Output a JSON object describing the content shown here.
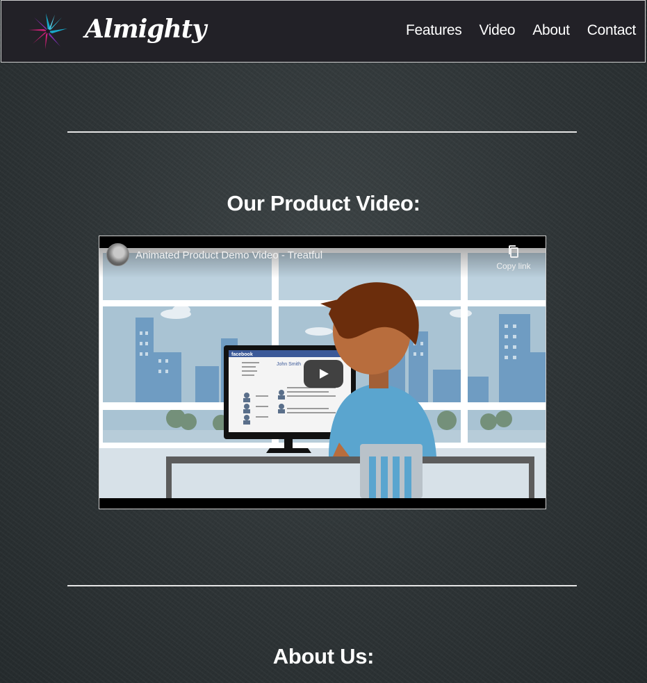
{
  "header": {
    "brand": "Almighty",
    "nav": [
      "Features",
      "Video",
      "About",
      "Contact"
    ]
  },
  "video_section": {
    "title": "Our Product Video:",
    "player": {
      "video_title": "Animated Product Demo Video - Treatful",
      "copy_link_label": "Copy link",
      "screen_app_name": "facebook",
      "screen_profile_name": "John Smith"
    }
  },
  "about_section": {
    "title": "About Us:"
  },
  "colors": {
    "header_bg": "#222127",
    "page_bg": "#2e3436",
    "text": "#ffffff",
    "logo_teal": "#19a7c8",
    "logo_magenta": "#d4207a",
    "logo_purple": "#7b2fb0"
  },
  "icons": {
    "logo": "starburst-logo-icon",
    "copy": "copy-icon",
    "play": "play-icon"
  }
}
